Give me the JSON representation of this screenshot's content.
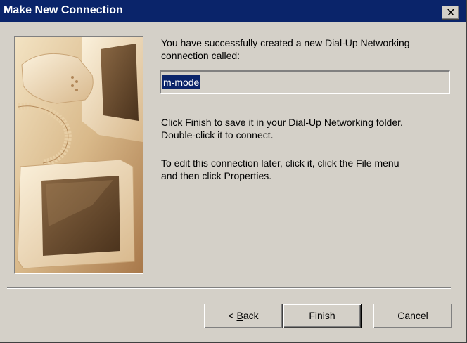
{
  "window": {
    "title": "Make New Connection"
  },
  "intro": {
    "line1": "You have successfully created a new Dial-Up Networking",
    "line2": "connection called:"
  },
  "connection_name": {
    "value": "m-mode"
  },
  "finish_note": {
    "line1": "Click Finish to save it in your Dial-Up Networking folder.",
    "line2": "Double-click it to connect."
  },
  "edit_note": {
    "line1": "To edit this connection later, click it, click the File menu",
    "line2": "and then click Properties."
  },
  "buttons": {
    "back_prefix": "< ",
    "back_accel": "B",
    "back_rest": "ack",
    "finish": "Finish",
    "cancel": "Cancel"
  },
  "icons": {
    "close": "close-icon",
    "illustration": "computer-monitor-illustration"
  },
  "colors": {
    "titlebar": "#0a246a",
    "face": "#d4d0c8",
    "selection": "#0a246a"
  }
}
